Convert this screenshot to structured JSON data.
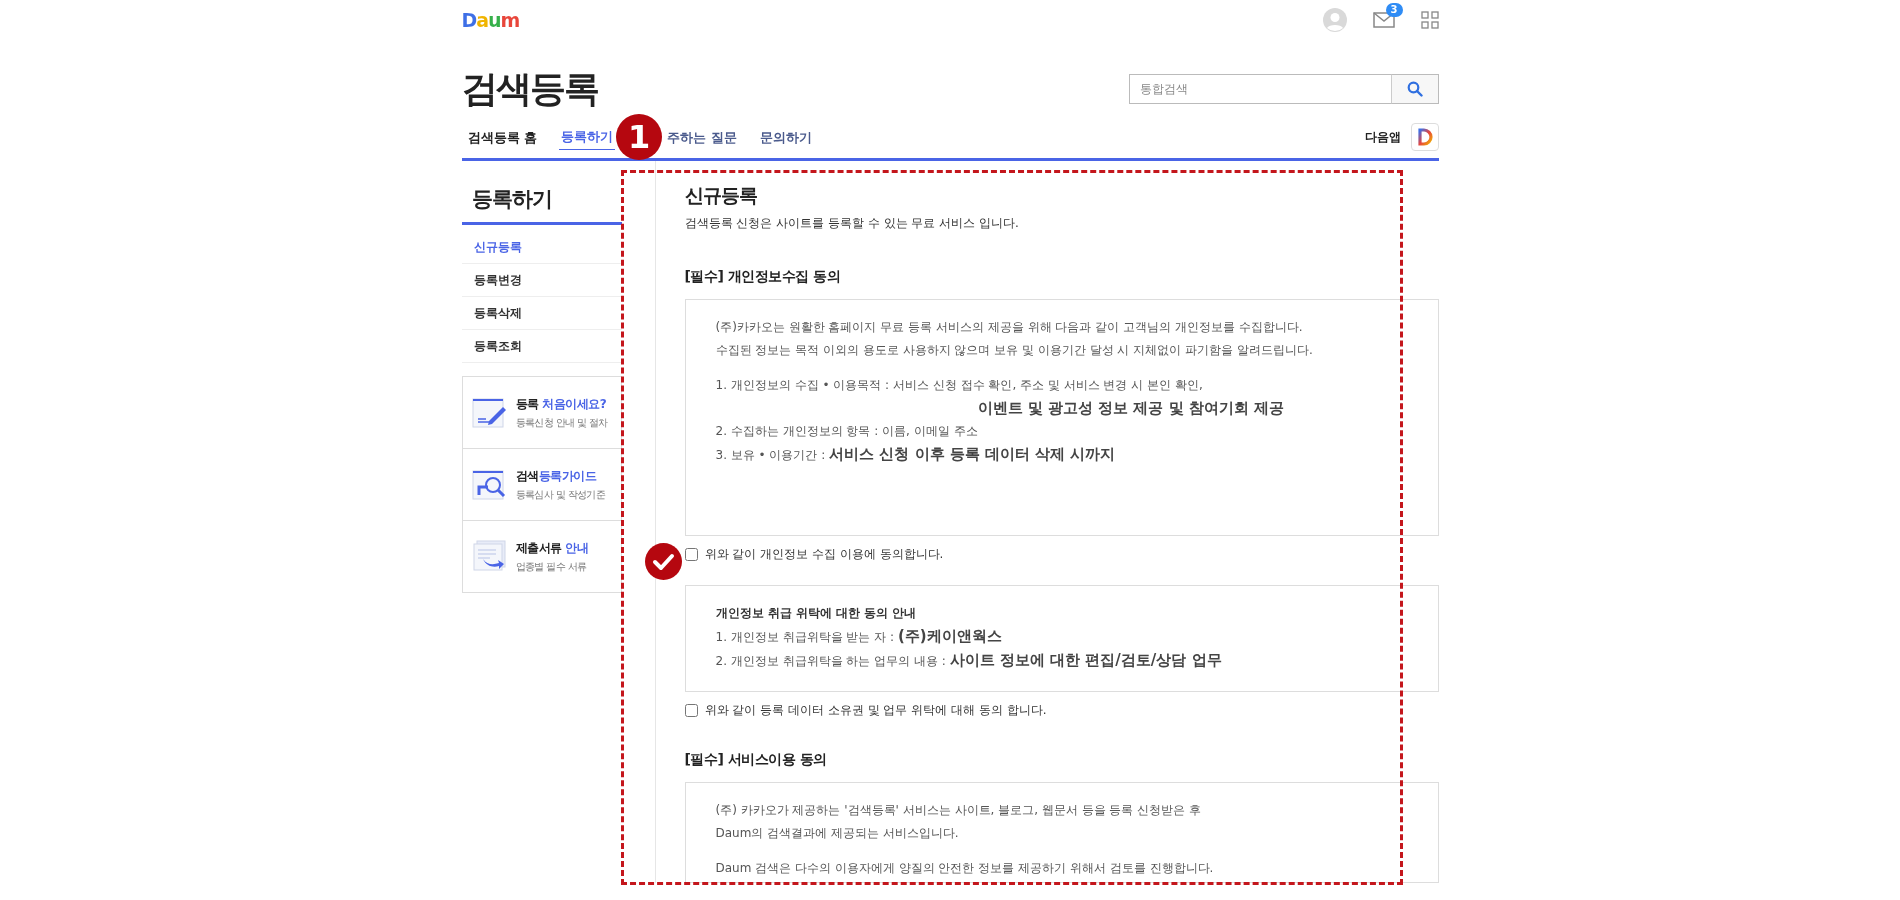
{
  "header": {
    "logo": "Daum",
    "mail_count": "3"
  },
  "page_title": "검색등록",
  "search": {
    "placeholder": "통합검색"
  },
  "tabs": [
    {
      "label": "검색등록 홈",
      "kind": "home",
      "selected": false
    },
    {
      "label": "등록하기",
      "kind": "link",
      "selected": true
    },
    {
      "label": "주하는 질문",
      "kind": "link",
      "selected": false
    },
    {
      "label": "문의하기",
      "kind": "link",
      "selected": false
    }
  ],
  "app_link": {
    "label": "다음앱"
  },
  "annotations": {
    "step_badge": "1"
  },
  "sidebar": {
    "title": "등록하기",
    "items": [
      {
        "label": "신규등록",
        "selected": true
      },
      {
        "label": "등록변경",
        "selected": false
      },
      {
        "label": "등록삭제",
        "selected": false
      },
      {
        "label": "등록조회",
        "selected": false
      }
    ],
    "promos": [
      {
        "kind": "first",
        "title": "등록 **처음이세요?**",
        "subtitle": "등록신청 안내 및 절차"
      },
      {
        "kind": "guide",
        "title": "검색**등록가이드**",
        "subtitle": "등록심사 및 작성기준"
      },
      {
        "kind": "documents",
        "title": "제출서류 **안내**",
        "subtitle": "업종별 필수 서류"
      }
    ]
  },
  "content": {
    "title": "신규등록",
    "subtitle": "검색등록 신청은 사이트를 등록할 수 있는 무료 서비스 입니다.",
    "sections": [
      {
        "kind": "box",
        "heading": "[필수] 개인정보수집 동의",
        "groups": [
          [
            {
              "kind": "plain",
              "text": "(주)카카오는 원활한 홈페이지 무료 등록 서비스의 제공을 위해 다음과 같이 고객님의 개인정보를 수집합니다."
            },
            {
              "kind": "plain",
              "text": "수집된 정보는 목적 이외의 용도로 사용하지 않으며 보유 및 이용기간 달성 시 지체없이 파기함을 알려드립니다."
            }
          ],
          [
            {
              "kind": "plain",
              "text": "1. 개인정보의 수집 • 이용목적 : 서비스 신청 접수 확인, 주소 및 서비스 변경 시 본인 확인,"
            },
            {
              "kind": "continuation",
              "text": "이벤트 및 광고성 정보 제공 및 참여기회 제공"
            },
            {
              "kind": "plain",
              "text": "2. 수집하는 개인정보의 항목 : 이름, 이메일 주소"
            },
            {
              "kind": "plain",
              "text": "3. 보유 • 이용기간 : **서비스 신청 이후 등록 데이터 삭제 시까지**"
            }
          ]
        ],
        "consent": {
          "label": "위와 같이 개인정보 수집 이용에 동의합니다.",
          "checked": false
        }
      },
      {
        "kind": "box",
        "groups": [
          [
            {
              "kind": "heading",
              "text": "개인정보 취급 위탁에 대한 동의 안내"
            },
            {
              "kind": "plain",
              "text": "1. 개인정보 취급위탁을 받는 자 : **(주)케이앤웍스**"
            },
            {
              "kind": "plain",
              "text": "2. 개인정보 취급위탁을 하는 업무의 내용 : **사이트 정보에 대한 편집/검토/상담 업무**"
            }
          ]
        ],
        "consent": {
          "label": "위와 같이 등록 데이터 소유권 및 업무 위탁에 대해 동의 합니다.",
          "checked": false
        }
      },
      {
        "kind": "box",
        "heading": "[필수] 서비스이용 동의",
        "groups": [
          [
            {
              "kind": "plain",
              "text": "(주) 카카오가 제공하는 '검색등록' 서비스는 사이트, 블로그, 웹문서 등을 등록 신청받은 후"
            },
            {
              "kind": "plain",
              "text": "Daum의 검색결과에 제공되는 서비스입니다."
            }
          ],
          [
            {
              "kind": "plain",
              "text": "Daum 검색은 다수의 이용자에게 양질의 안전한 정보를 제공하기 위해서 검토를 진행합니다."
            }
          ]
        ]
      }
    ]
  }
}
